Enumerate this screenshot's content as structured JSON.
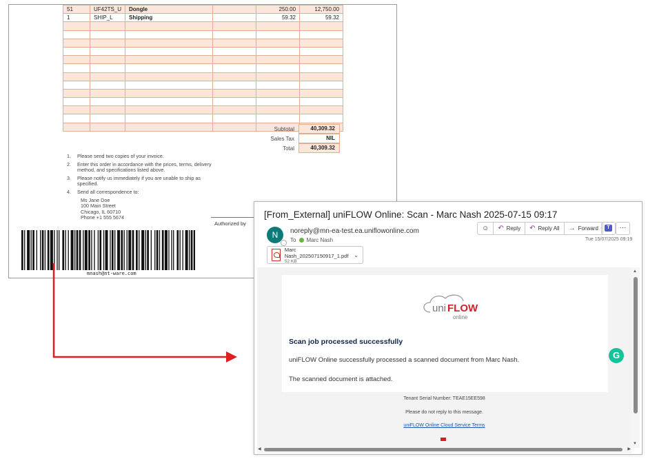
{
  "document": {
    "rows": [
      {
        "qty": "51",
        "item": "UF42TS_U",
        "desc": "Dongle",
        "blank": "",
        "price": "250.00",
        "amount": "12,750.00"
      },
      {
        "qty": "1",
        "item": "SHIP_L",
        "desc": "Shipping",
        "blank": "",
        "price": "59.32",
        "amount": "59.32"
      }
    ],
    "subtotal_label": "Subtotal",
    "subtotal_value": "40,309.32",
    "tax_label": "Sales Tax",
    "tax_value": "NIL",
    "total_label": "Total",
    "total_value": "40,309.32",
    "notes": [
      {
        "num": "1.",
        "text": "Please send two copies of your invoice."
      },
      {
        "num": "2.",
        "text": "Enter this order in accordance with the prices, terms, delivery method, and specifications listed above."
      },
      {
        "num": "3.",
        "text": "Please notify us immediately if you are unable to ship as specified."
      },
      {
        "num": "4.",
        "text": "Send all correspondence to:"
      }
    ],
    "address": [
      "Ms Jane Doe",
      "100 Main Street",
      "Chicago, IL 60710",
      "Phone +1 555 5674"
    ],
    "authorized_by": "Authorized by",
    "barcode_text": "mnash@nt-ware.com"
  },
  "email": {
    "subject": "[From_External] uniFLOW Online: Scan - Marc Nash 2025-07-15 09:17",
    "avatar_letter": "N",
    "from": "noreply@mn-ea-test.ea.uniflowonline.com",
    "to_label": "To",
    "to_name": "Marc Nash",
    "emoji_icon": "☺",
    "reply": "Reply",
    "reply_all": "Reply All",
    "forward": "Forward",
    "more": "···",
    "datetime": "Tue 15/07/2025 09:19",
    "attachment_name": "Marc Nash_202507150917_1.pdf",
    "attachment_size": "52 KB",
    "logo_uni": "uni",
    "logo_flow": "FLOW",
    "logo_online": "online",
    "heading": "Scan job processed successfully",
    "line1": "uniFLOW Online successfully processed a scanned document from Marc Nash.",
    "line2": "The scanned document is attached.",
    "tenant": "Tenant Serial Number: TEAE15EE598",
    "noreply_note": "Please do not reply to this message.",
    "terms_link": "uniFLOW Online Cloud Service Terms",
    "grammarly": "G"
  },
  "colors": {
    "row_shade": "#fbe6db",
    "border": "#e3ad93",
    "arrow": "#e01f1f",
    "avatar": "#0e7b7b",
    "heading": "#10234a",
    "link": "#1a56b0",
    "uniflow_red": "#d21f2a"
  }
}
